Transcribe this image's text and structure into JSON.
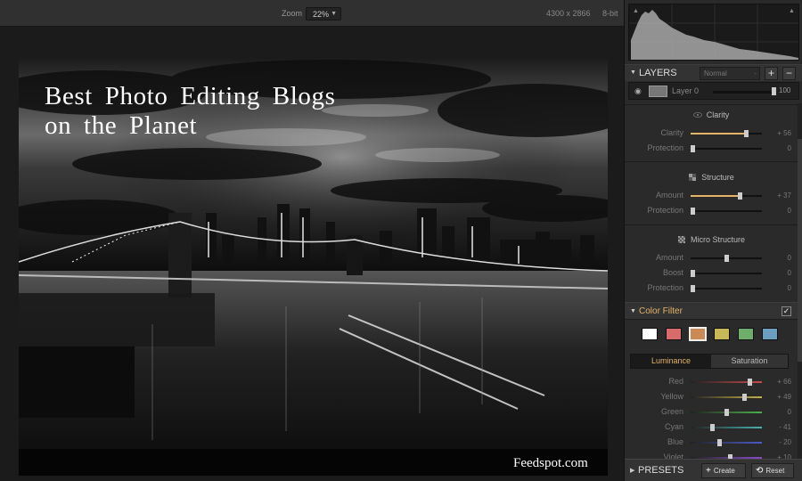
{
  "toolbar": {
    "zoom_label": "Zoom",
    "zoom_value": "22%",
    "image_dimensions": "4300 x 2866",
    "bit_depth": "8-bit"
  },
  "canvas": {
    "overlay_title_line1": "Best Photo Editing Blogs",
    "overlay_title_line2": "on the Planet",
    "watermark": "Feedspot.com"
  },
  "layers": {
    "title": "LAYERS",
    "blend_mode": "Normal",
    "add_label": "+",
    "remove_label": "−",
    "items": [
      {
        "name": "Layer 0",
        "opacity": "100"
      }
    ]
  },
  "clarity": {
    "title": "Clarity",
    "rows": [
      {
        "label": "Clarity",
        "value": "+ 56",
        "amount": 56
      },
      {
        "label": "Protection",
        "value": "0",
        "amount": 0
      }
    ]
  },
  "structure": {
    "title": "Structure",
    "rows": [
      {
        "label": "Amount",
        "value": "+ 37",
        "amount": 37
      },
      {
        "label": "Protection",
        "value": "0",
        "amount": 0
      }
    ]
  },
  "micro_structure": {
    "title": "Micro Structure",
    "rows": [
      {
        "label": "Amount",
        "value": "0",
        "amount": 0
      },
      {
        "label": "Boost",
        "value": "0",
        "amount": 0
      },
      {
        "label": "Protection",
        "value": "0",
        "amount": 0
      }
    ]
  },
  "color_filter": {
    "title": "Color Filter",
    "enabled": true,
    "swatches": [
      "#ffffff",
      "#d66b6b",
      "#c98a56",
      "#c9b85a",
      "#6fae6a",
      "#6f9fc0"
    ],
    "selected_swatch": 2,
    "tabs": [
      "Luminance",
      "Saturation"
    ],
    "active_tab": "Luminance",
    "rows": [
      {
        "label": "Red",
        "value": "+ 66",
        "amount": 66,
        "color": "#c84a4a"
      },
      {
        "label": "Yellow",
        "value": "+ 49",
        "amount": 49,
        "color": "#c8b04a"
      },
      {
        "label": "Green",
        "value": "0",
        "amount": 0,
        "color": "#4ab04a"
      },
      {
        "label": "Cyan",
        "value": "- 41",
        "amount": -41,
        "color": "#4ab0b0"
      },
      {
        "label": "Blue",
        "value": "- 20",
        "amount": -20,
        "color": "#4a5ac8"
      },
      {
        "label": "Violet",
        "value": "+ 10",
        "amount": 10,
        "color": "#8a4ac8"
      }
    ]
  },
  "presets": {
    "title": "PRESETS",
    "create_label": "Create",
    "reset_label": "Reset"
  },
  "colors": {
    "accent": "#e4b36a",
    "panel_bg": "#2a2a2a",
    "canvas_bg": "#1b1b1b"
  }
}
